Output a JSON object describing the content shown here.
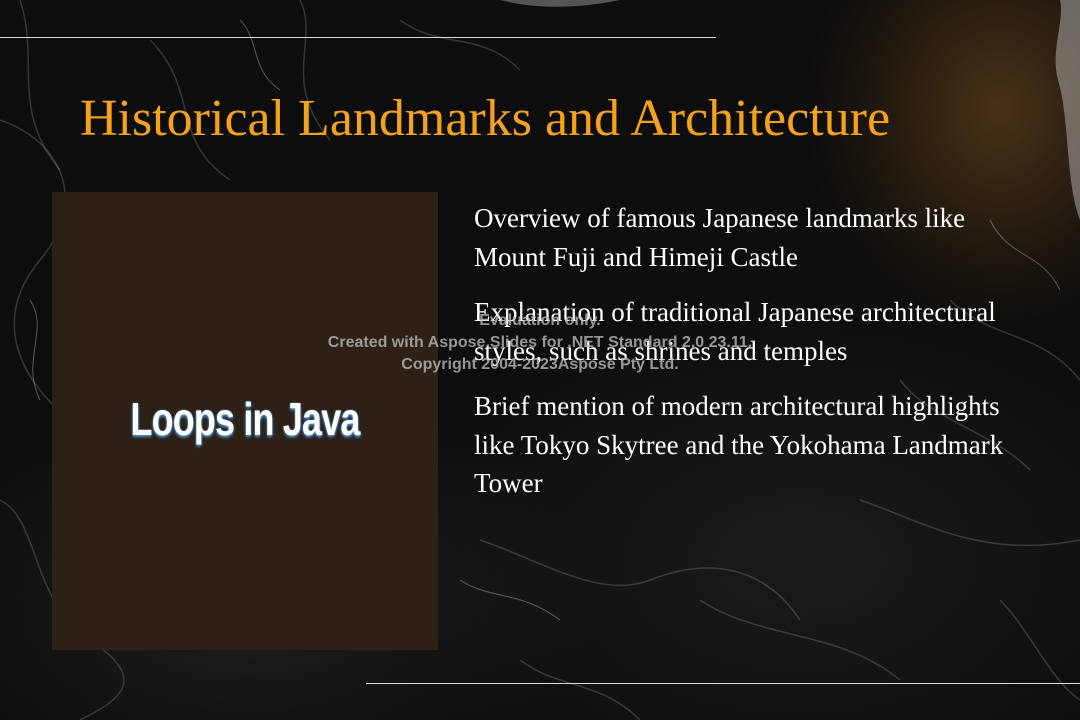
{
  "slide": {
    "title": "Historical Landmarks and Architecture",
    "picture_text": "Loops in Java",
    "bullets": [
      "Overview of famous Japanese landmarks like Mount Fuji and Himeji Castle",
      "Explanation of traditional Japanese architectural styles, such as shrines and temples",
      "Brief mention of modern architectural highlights like Tokyo Skytree and the Yokohama Landmark Tower"
    ]
  },
  "watermark": {
    "line1": "Evaluation only.",
    "line2": "Created with Aspose.Slides for .NET Standard 2.0 23.11.",
    "line3": "Copyright 2004-2023Aspose Pty Ltd."
  },
  "colors": {
    "title": "#f3a21a",
    "picture_bg": "#2c2114",
    "text": "#ffffff"
  }
}
